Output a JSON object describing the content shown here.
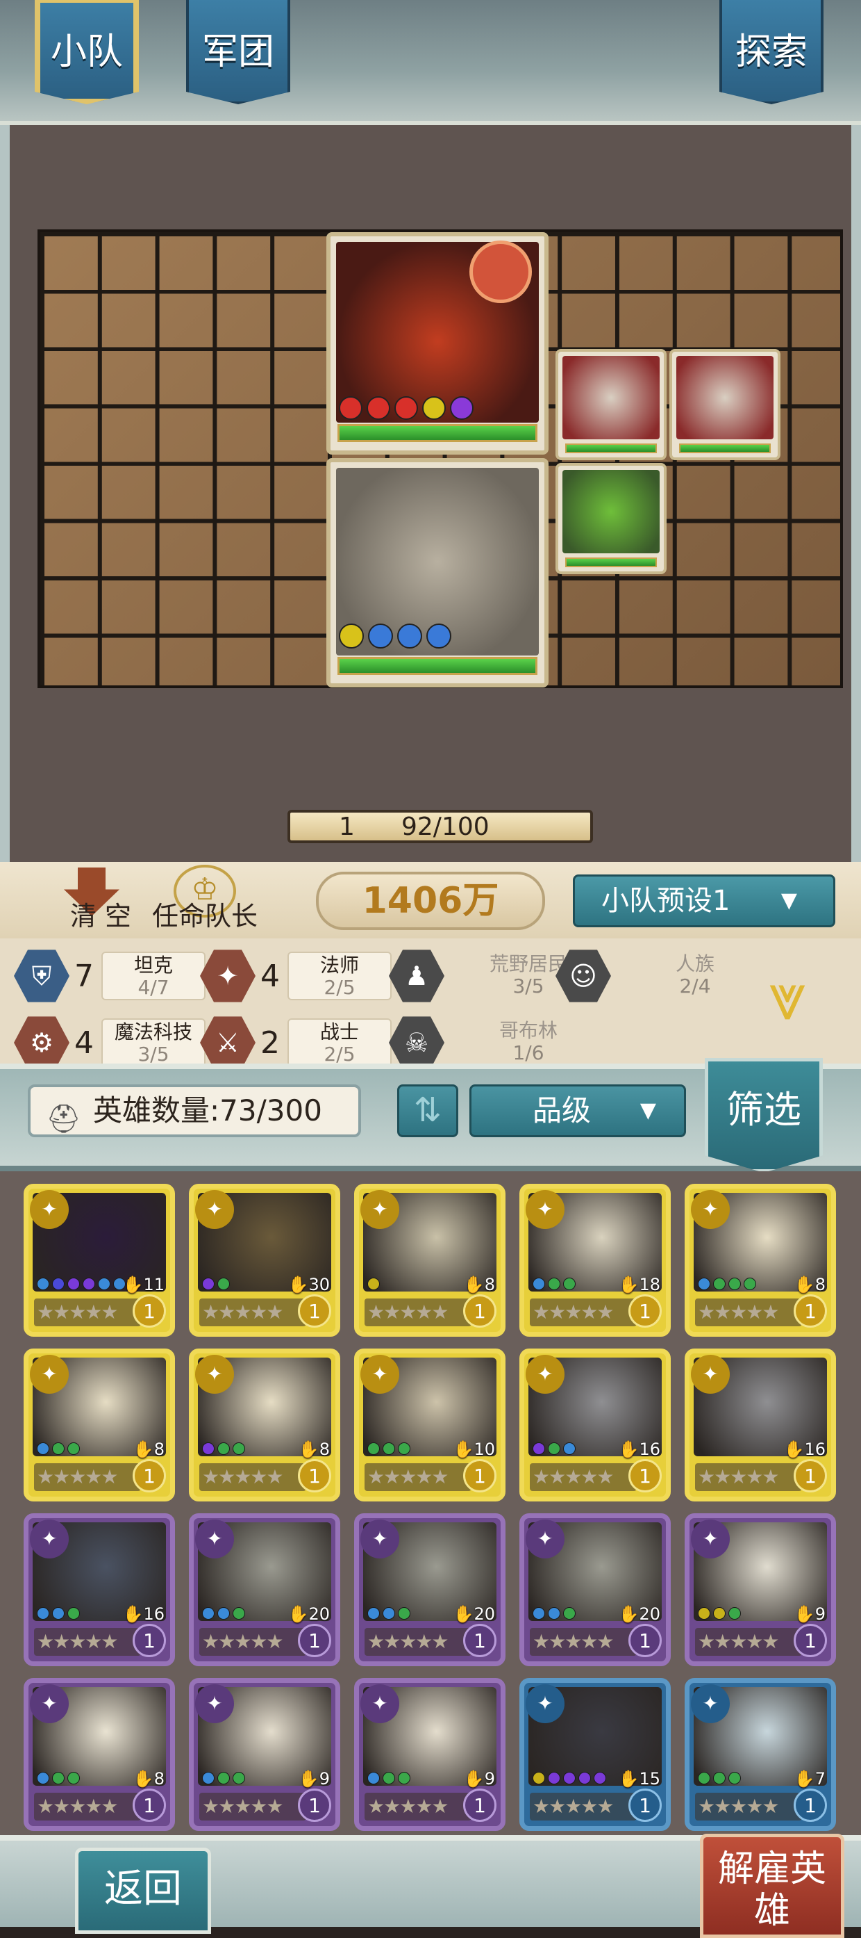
{
  "tabs": {
    "squad": "小队",
    "legion": "军团",
    "explore": "探索"
  },
  "board": {
    "level": "1",
    "progress_text": "92/100",
    "progress_value": 0.92
  },
  "actions": {
    "clear": "清 空",
    "appoint_leader": "任命队长"
  },
  "power": "1406万",
  "preset": {
    "label": "小队预设1",
    "caret": "▼"
  },
  "traits": [
    {
      "count": "7",
      "name": "坦克",
      "progress": "4/7",
      "icon": "shield-icon",
      "color": "#3a5e86",
      "dim": false
    },
    {
      "count": "4",
      "name": "法师",
      "progress": "2/5",
      "icon": "mage-icon",
      "color": "#8a4a3a",
      "dim": false
    },
    {
      "count": "",
      "name": "荒野居民",
      "progress": "3/5",
      "icon": "wildling-icon",
      "color": "#4a4a4a",
      "dim": true
    },
    {
      "count": "",
      "name": "人族",
      "progress": "2/4",
      "icon": "human-icon",
      "color": "#4a4a4a",
      "dim": true
    },
    {
      "count": "4",
      "name": "魔法科技",
      "progress": "3/5",
      "icon": "magitech-icon",
      "color": "#8a4a3a",
      "dim": false
    },
    {
      "count": "2",
      "name": "战士",
      "progress": "2/5",
      "icon": "warrior-icon",
      "color": "#8a4a3a",
      "dim": false
    },
    {
      "count": "",
      "name": "哥布林",
      "progress": "1/6",
      "icon": "goblin-icon",
      "color": "#4a4a4a",
      "dim": true
    }
  ],
  "hero_toolbar": {
    "count_label": "英雄数量:73/300",
    "sort_icon": "sort-icon",
    "rarity_label": "品级",
    "rarity_caret": "▼",
    "filter_label": "筛选"
  },
  "heroes": [
    {
      "rarity": "gold",
      "cost": "11",
      "level": "1",
      "stars": "★★★★★",
      "art": "#2b1c3a",
      "gems": [
        "#3a8ad8",
        "#4a4ad8",
        "#7a3ad8",
        "#7a3ad8",
        "#3a8ad8",
        "#3a8ad8"
      ]
    },
    {
      "rarity": "gold",
      "cost": "30",
      "level": "1",
      "stars": "★★★★★",
      "art": "#6a5a3a",
      "gems": [
        "#7a3ad8",
        "#3aa84a"
      ]
    },
    {
      "rarity": "gold",
      "cost": "8",
      "level": "1",
      "stars": "★★★★★",
      "art": "#c9c1a8",
      "gems": [
        "#c9b21a"
      ]
    },
    {
      "rarity": "gold",
      "cost": "18",
      "level": "1",
      "stars": "★★★★★",
      "art": "#d9d2be",
      "gems": [
        "#3a8ad8",
        "#3aa84a",
        "#3aa84a"
      ]
    },
    {
      "rarity": "gold",
      "cost": "8",
      "level": "1",
      "stars": "★★★★★",
      "art": "#e6ddc4",
      "gems": [
        "#3a8ad8",
        "#3aa84a",
        "#3aa84a",
        "#3aa84a"
      ]
    },
    {
      "rarity": "gold",
      "cost": "8",
      "level": "1",
      "stars": "★★★★★",
      "art": "#e6ddc4",
      "gems": [
        "#3a8ad8",
        "#3aa84a",
        "#3aa84a"
      ]
    },
    {
      "rarity": "gold",
      "cost": "8",
      "level": "1",
      "stars": "★★★★★",
      "art": "#e6ddc4",
      "gems": [
        "#7a3ad8",
        "#3aa84a",
        "#3aa84a"
      ]
    },
    {
      "rarity": "gold",
      "cost": "10",
      "level": "1",
      "stars": "★★★★★",
      "art": "#cdc3aa",
      "gems": [
        "#3aa84a",
        "#3aa84a",
        "#3aa84a"
      ]
    },
    {
      "rarity": "gold",
      "cost": "16",
      "level": "1",
      "stars": "★★★★★",
      "art": "#8f8f92",
      "gems": [
        "#7a3ad8",
        "#3aa84a",
        "#3a8ad8"
      ]
    },
    {
      "rarity": "gold",
      "cost": "16",
      "level": "1",
      "stars": "★★★★★",
      "art": "#8f8f92",
      "gems": []
    },
    {
      "rarity": "purple",
      "cost": "16",
      "level": "1",
      "stars": "★★★★★",
      "art": "#4a5262",
      "gems": [
        "#3a8ad8",
        "#3a8ad8",
        "#3aa84a"
      ]
    },
    {
      "rarity": "purple",
      "cost": "20",
      "level": "1",
      "stars": "★★★★★",
      "art": "#9a9a90",
      "gems": [
        "#3a8ad8",
        "#3a8ad8",
        "#3aa84a"
      ]
    },
    {
      "rarity": "purple",
      "cost": "20",
      "level": "1",
      "stars": "★★★★★",
      "art": "#9a9a90",
      "gems": [
        "#3a8ad8",
        "#3a8ad8",
        "#3aa84a"
      ]
    },
    {
      "rarity": "purple",
      "cost": "20",
      "level": "1",
      "stars": "★★★★★",
      "art": "#9a9a90",
      "gems": [
        "#3a8ad8",
        "#3a8ad8",
        "#3aa84a"
      ]
    },
    {
      "rarity": "purple",
      "cost": "9",
      "level": "1",
      "stars": "★★★★★",
      "art": "#e0dccf",
      "gems": [
        "#c9b21a",
        "#c9b21a",
        "#3aa84a"
      ]
    },
    {
      "rarity": "purple",
      "cost": "8",
      "level": "1",
      "stars": "★★★★★",
      "art": "#e9e3d2",
      "gems": [
        "#3a8ad8",
        "#3aa84a",
        "#3aa84a"
      ]
    },
    {
      "rarity": "purple",
      "cost": "9",
      "level": "1",
      "stars": "★★★★★",
      "art": "#e4ddcd",
      "gems": [
        "#3a8ad8",
        "#3aa84a",
        "#3aa84a"
      ]
    },
    {
      "rarity": "purple",
      "cost": "9",
      "level": "1",
      "stars": "★★★★★",
      "art": "#e4ddcd",
      "gems": [
        "#3a8ad8",
        "#3aa84a",
        "#3aa84a"
      ]
    },
    {
      "rarity": "blue",
      "cost": "15",
      "level": "1",
      "stars": "★★★★★",
      "art": "#3a3a42",
      "gems": [
        "#c9b21a",
        "#7a3ad8",
        "#7a3ad8",
        "#7a3ad8",
        "#7a3ad8"
      ]
    },
    {
      "rarity": "blue",
      "cost": "7",
      "level": "1",
      "stars": "★★★★★",
      "art": "#c7d6dc",
      "gems": [
        "#3aa84a",
        "#3aa84a",
        "#3aa84a"
      ]
    }
  ],
  "bottom": {
    "back": "返回",
    "dismiss": "解雇英雄"
  }
}
